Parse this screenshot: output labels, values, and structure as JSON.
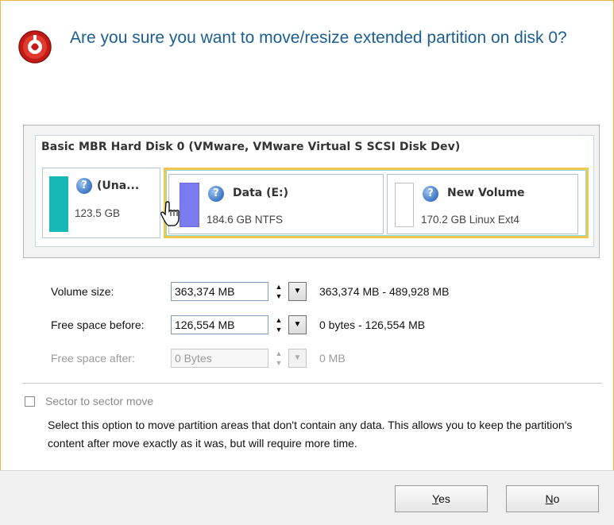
{
  "dialog": {
    "question": "Are you sure you want to move/resize extended partition on disk 0?"
  },
  "disk": {
    "title": "Basic MBR Hard Disk 0 (VMware, VMware Virtual S SCSI Disk Dev)",
    "partitions": [
      {
        "name": "(Una...",
        "size": "123.5 GB",
        "color": "#17b8b6"
      },
      {
        "name": "Data (E:)",
        "size": "184.6 GB NTFS",
        "color": "#7c7cf0"
      },
      {
        "name": "New Volume",
        "size": "170.2 GB Linux Ext4",
        "color": "#ffffff"
      }
    ]
  },
  "fields": {
    "volume_size": {
      "label": "Volume size:",
      "value": "363,374 MB",
      "range": "363,374 MB - 489,928 MB"
    },
    "free_before": {
      "label": "Free space before:",
      "value": "126,554 MB",
      "range": "0 bytes - 126,554 MB"
    },
    "free_after": {
      "label": "Free space after:",
      "value": "0 Bytes",
      "range": "0 MB"
    }
  },
  "option": {
    "checkbox_label": "Sector to sector move",
    "checked": false,
    "description": "Select this option to move partition areas that don't contain any data. This allows you to keep the partition's content after move exactly as it was, but will require more time."
  },
  "buttons": {
    "yes_mnemonic": "Y",
    "yes_rest": "es",
    "no_mnemonic": "N",
    "no_rest": "o"
  },
  "icons": {
    "header": "disk-wizard-icon",
    "partition": "question-icon",
    "cursor": "hand-cursor-icon"
  }
}
